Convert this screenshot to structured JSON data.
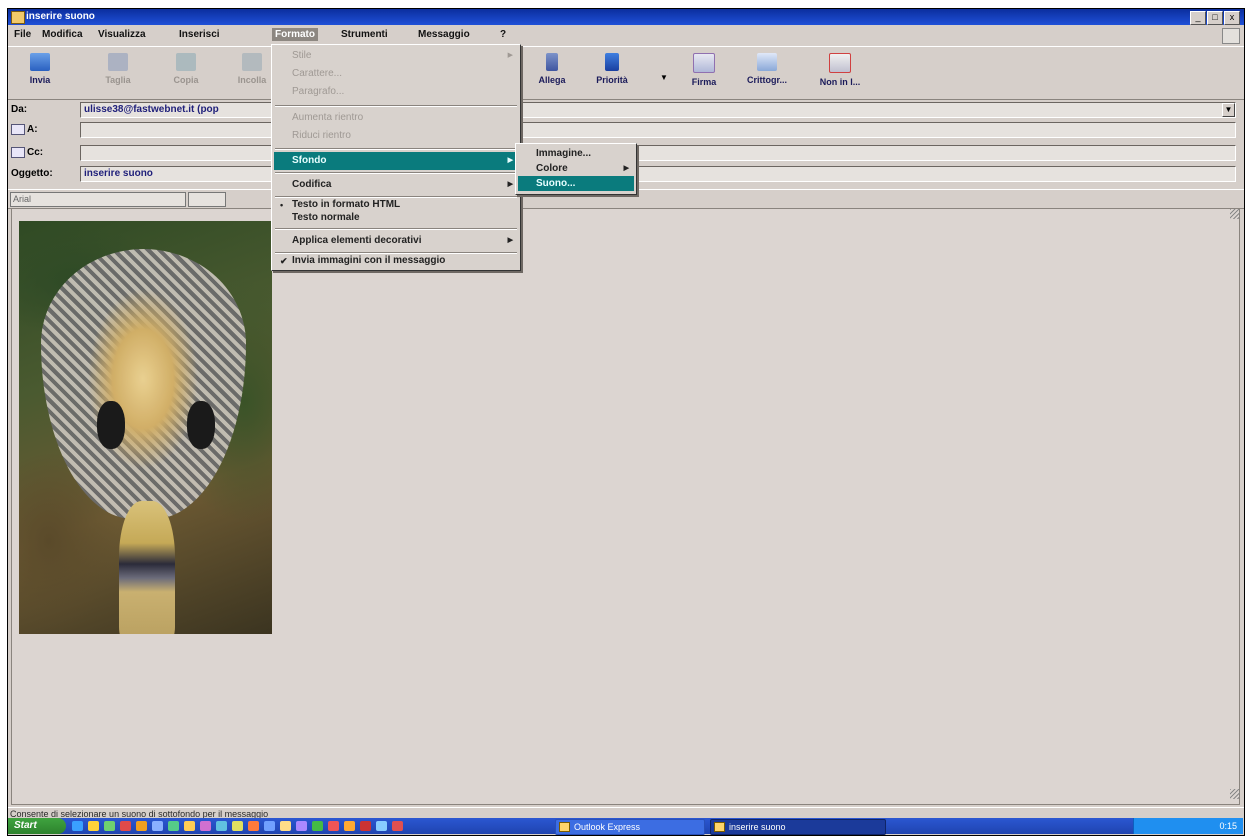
{
  "window": {
    "title": "inserire suono",
    "controls": [
      "_",
      "□",
      "x"
    ]
  },
  "menubar": [
    "File",
    "Modifica",
    "Visualizza",
    "Inserisci",
    "Formato",
    "Strumenti",
    "Messaggio",
    "?"
  ],
  "toolbar": {
    "invia": "Invia",
    "taglia": "Taglia",
    "copia": "Copia",
    "incolla": "Incolla",
    "allega": "Allega",
    "priorita": "Priorità",
    "firma": "Firma",
    "crittogr": "Crittogr...",
    "non_in_linea": "Non in l..."
  },
  "headers": {
    "da_label": "Da:",
    "da_value": "ulisse38@fastwebnet.it   (pop",
    "a_label": "A:",
    "cc_label": "Cc:",
    "oggetto_label": "Oggetto:",
    "oggetto_value": "inserire suono"
  },
  "format_bar": {
    "font": "Arial"
  },
  "formato_menu": {
    "items": {
      "stile": "Stile",
      "carattere": "Carattere...",
      "paragrafo": "Paragrafo...",
      "aumenta_rientro": "Aumenta rientro",
      "riduci_rientro": "Riduci rientro",
      "sfondo": "Sfondo",
      "codifica": "Codifica",
      "testo_html": "Testo in formato HTML",
      "testo_normale": "Testo normale",
      "applica_elementi": "Applica elementi decorativi",
      "invia_immagini": "Invia immagini con il messaggio"
    },
    "marks": {
      "html_bullet": "•",
      "invia_check": "✔"
    }
  },
  "sfondo_submenu": {
    "immagine": "Immagine...",
    "colore": "Colore",
    "suono": "Suono..."
  },
  "statusbar": "Consente di selezionare un suono di sottofondo per il messaggio",
  "taskbar": {
    "start": "Start",
    "tasks": [
      "Outlook Express",
      "inserire suono"
    ],
    "clock": "0:15"
  },
  "colors": {
    "menu_highlight": "#0a7b7d",
    "titlebar": "#1f50d8",
    "chrome": "#d6cfca"
  }
}
